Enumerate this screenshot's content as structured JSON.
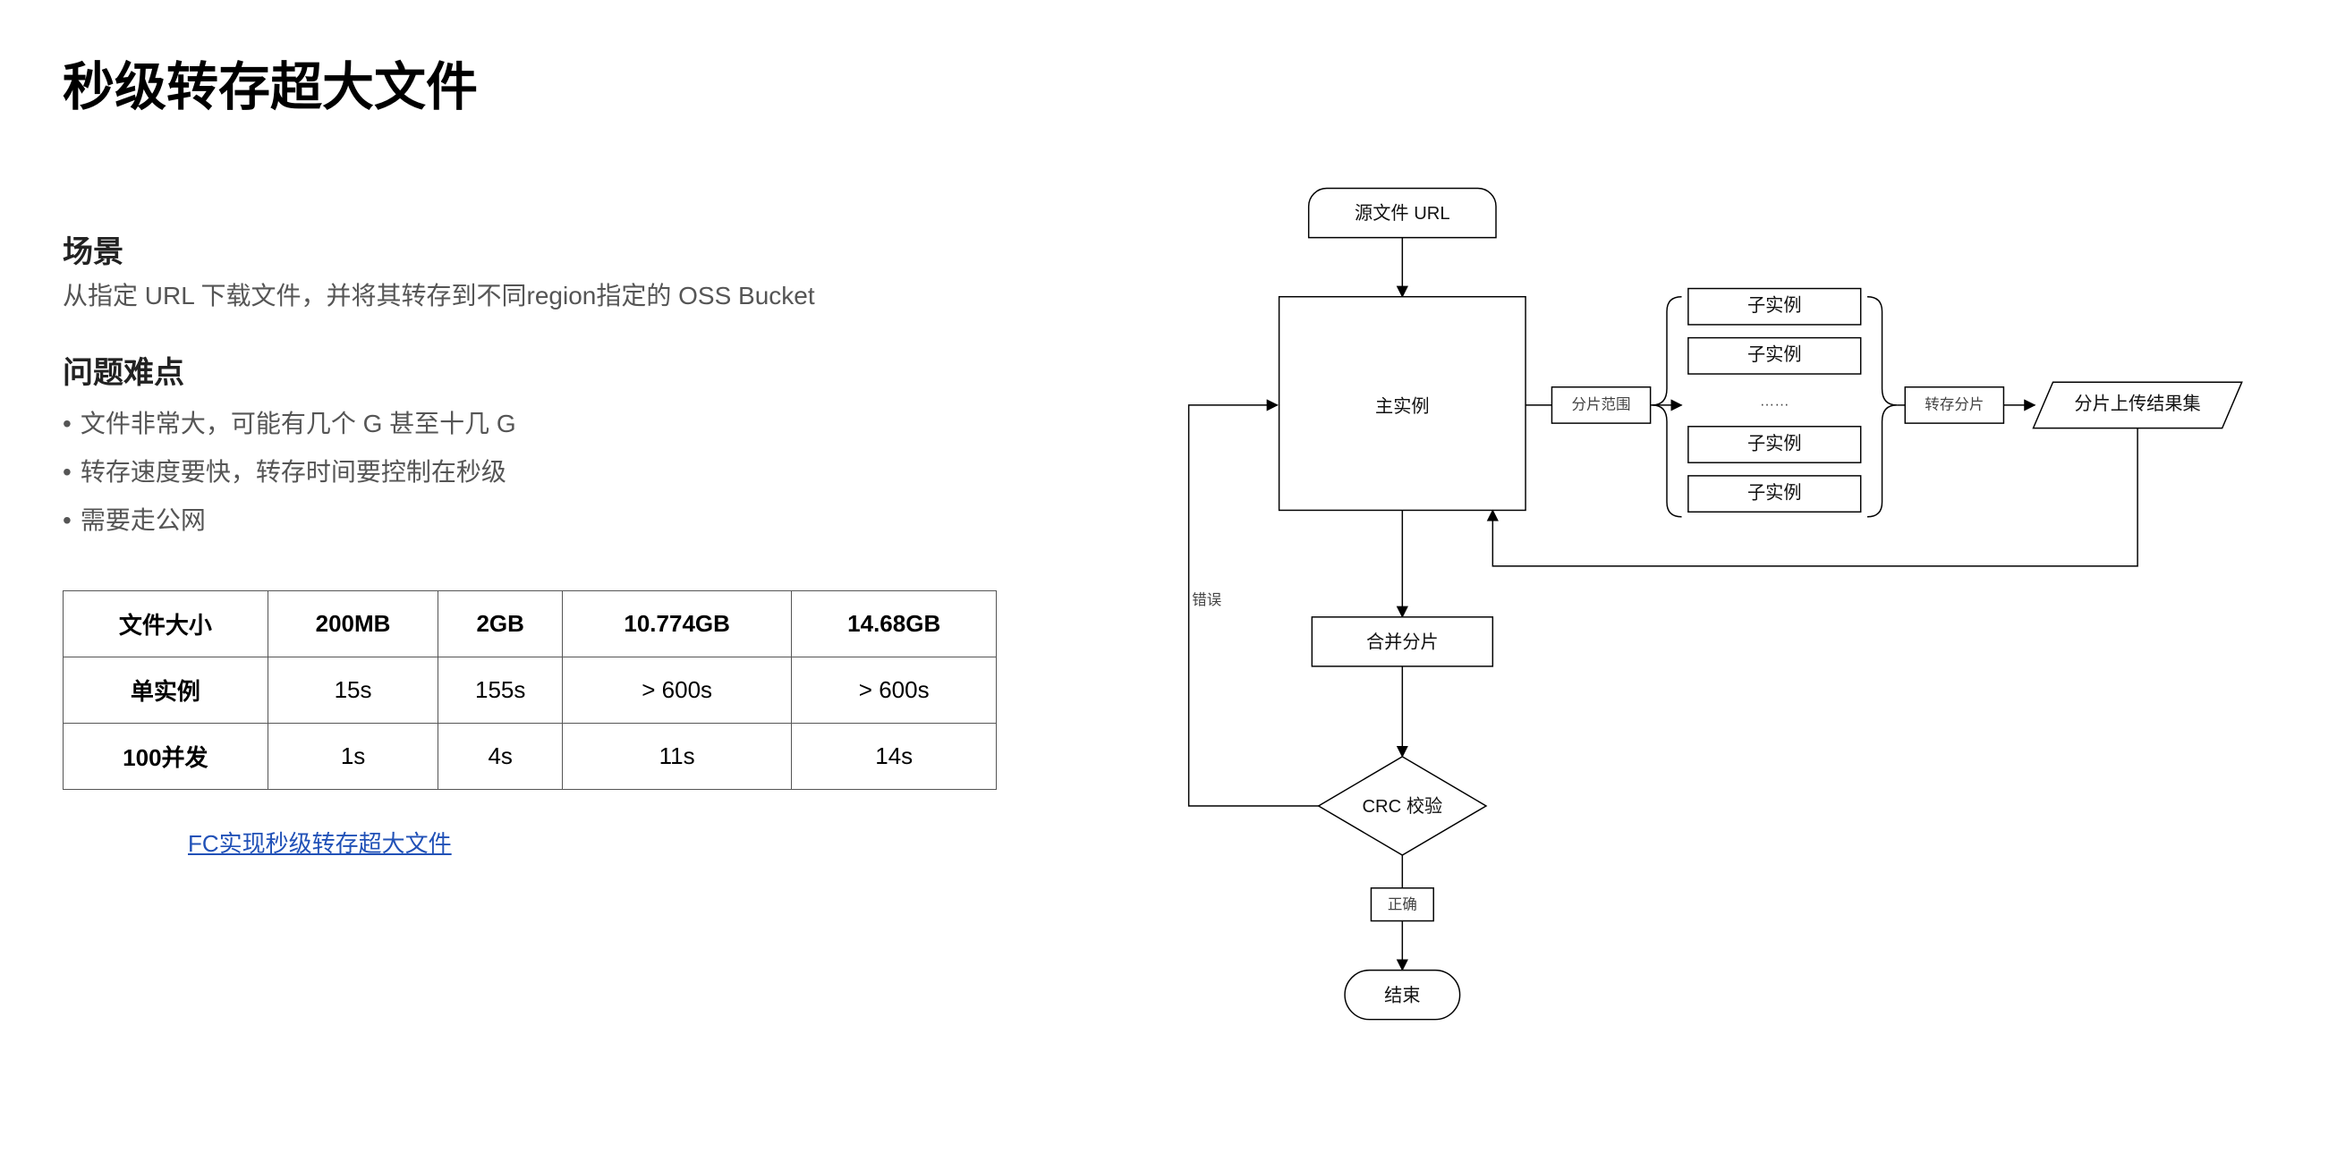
{
  "title": "秒级转存超大文件",
  "scenario": {
    "heading": "场景",
    "desc": "从指定 URL 下载文件，并将其转存到不同region指定的 OSS Bucket"
  },
  "difficulty": {
    "heading": "问题难点",
    "items": [
      "文件非常大，可能有几个 G 甚至十几 G",
      "转存速度要快，转存时间要控制在秒级",
      "需要走公网"
    ]
  },
  "table": {
    "headers": [
      "文件大小",
      "200MB",
      "2GB",
      "10.774GB",
      "14.68GB"
    ],
    "rows": [
      {
        "label": "单实例",
        "cells": [
          "15s",
          "155s",
          "> 600s",
          "> 600s"
        ]
      },
      {
        "label": "100并发",
        "cells": [
          "1s",
          "4s",
          "11s",
          "14s"
        ]
      }
    ]
  },
  "link_text": "FC实现秒级转存超大文件",
  "flow": {
    "source_url": "源文件 URL",
    "main_instance": "主实例",
    "shard_range": "分片范围",
    "sub_instance": "子实例",
    "ellipsis": "……",
    "store_shard": "转存分片",
    "upload_result": "分片上传结果集",
    "error": "错误",
    "merge": "合并分片",
    "crc": "CRC 校验",
    "correct": "正确",
    "end": "结束"
  }
}
